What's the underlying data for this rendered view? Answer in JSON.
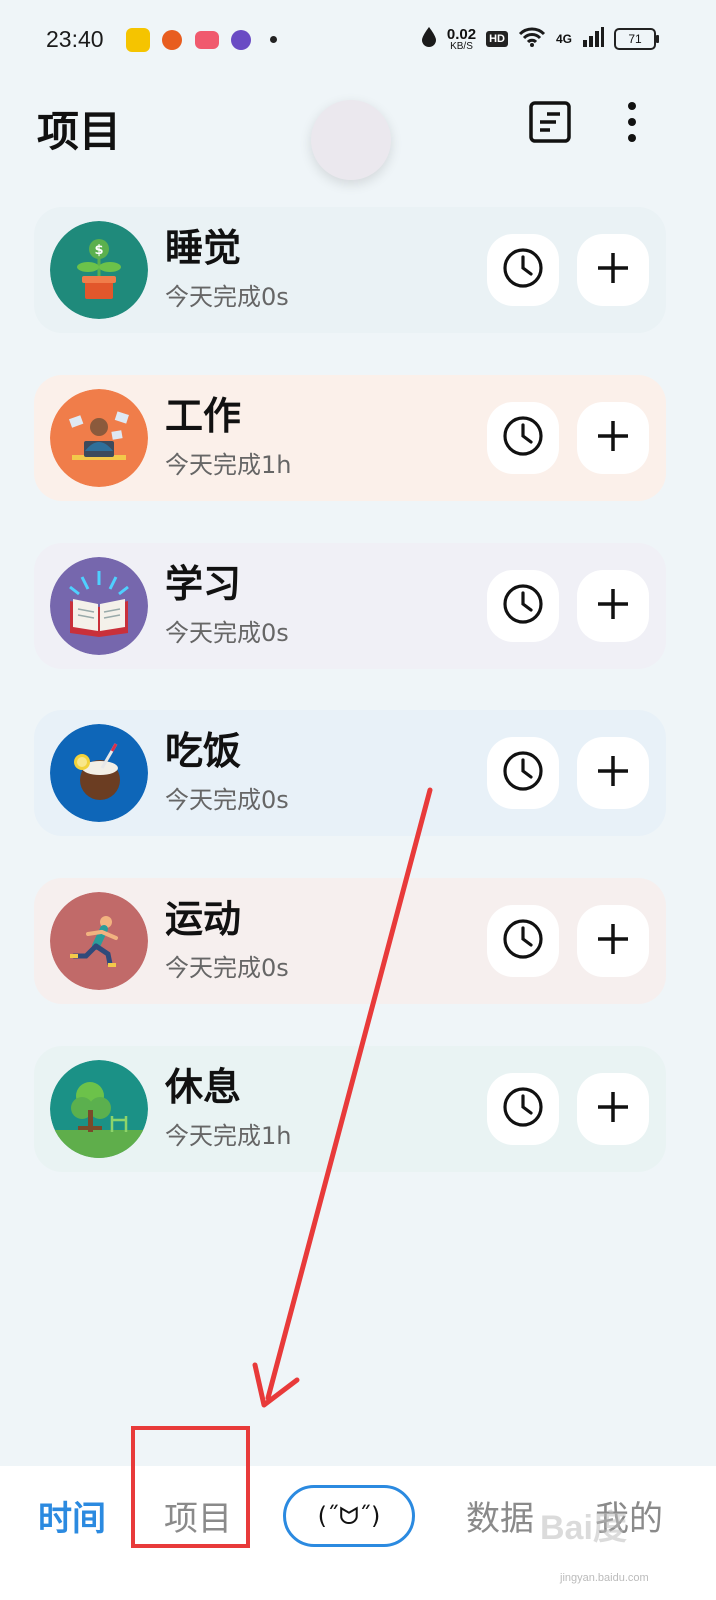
{
  "status_bar": {
    "time": "23:40",
    "speed_value": "0.02",
    "speed_unit": "KB/S",
    "hd_label": "HD",
    "network_label": "4G",
    "battery": "71",
    "icons": [
      "tomcat-app-icon",
      "basketball-app-icon",
      "game-app-icon",
      "browser-app-icon",
      "notification-dot",
      "drop-icon",
      "wifi-icon",
      "signal-icon",
      "battery-icon"
    ]
  },
  "header": {
    "title": "项目",
    "icons": [
      "list-icon",
      "more-vertical-icon"
    ]
  },
  "projects": [
    {
      "name": "睡觉",
      "today": "今天完成0s",
      "icon": "money-plant-icon",
      "color": "#1f8a7b",
      "card_bg": "#eaf2f5"
    },
    {
      "name": "工作",
      "today": "今天完成1h",
      "icon": "office-worker-icon",
      "color": "#f07d4a",
      "card_bg": "#fbf0ea"
    },
    {
      "name": "学习",
      "today": "今天完成0s",
      "icon": "open-book-icon",
      "color": "#7667ad",
      "card_bg": "#f0f0f6"
    },
    {
      "name": "吃饭",
      "today": "今天完成0s",
      "icon": "coconut-drink-icon",
      "color": "#0e66b8",
      "card_bg": "#e8f1f8"
    },
    {
      "name": "运动",
      "today": "今天完成0s",
      "icon": "runner-icon",
      "color": "#c16a69",
      "card_bg": "#f6efee"
    },
    {
      "name": "休息",
      "today": "今天完成1h",
      "icon": "park-tree-icon",
      "color": "#1b9186",
      "card_bg": "#e9f3f3"
    }
  ],
  "card_actions": {
    "timer_icon": "clock-icon",
    "add_icon": "plus-icon"
  },
  "bottom_nav": {
    "time": "时间",
    "projects": "项目",
    "center": "(˝ᗢ˝)",
    "data": "数据",
    "mine": "我的",
    "active_color": "#2b8ae0",
    "inactive_color": "#8a8a8a"
  },
  "annotation": {
    "color": "#e83a3a"
  },
  "watermark": {
    "text": "Bai度",
    "sub": "jingyan.baidu.com"
  }
}
